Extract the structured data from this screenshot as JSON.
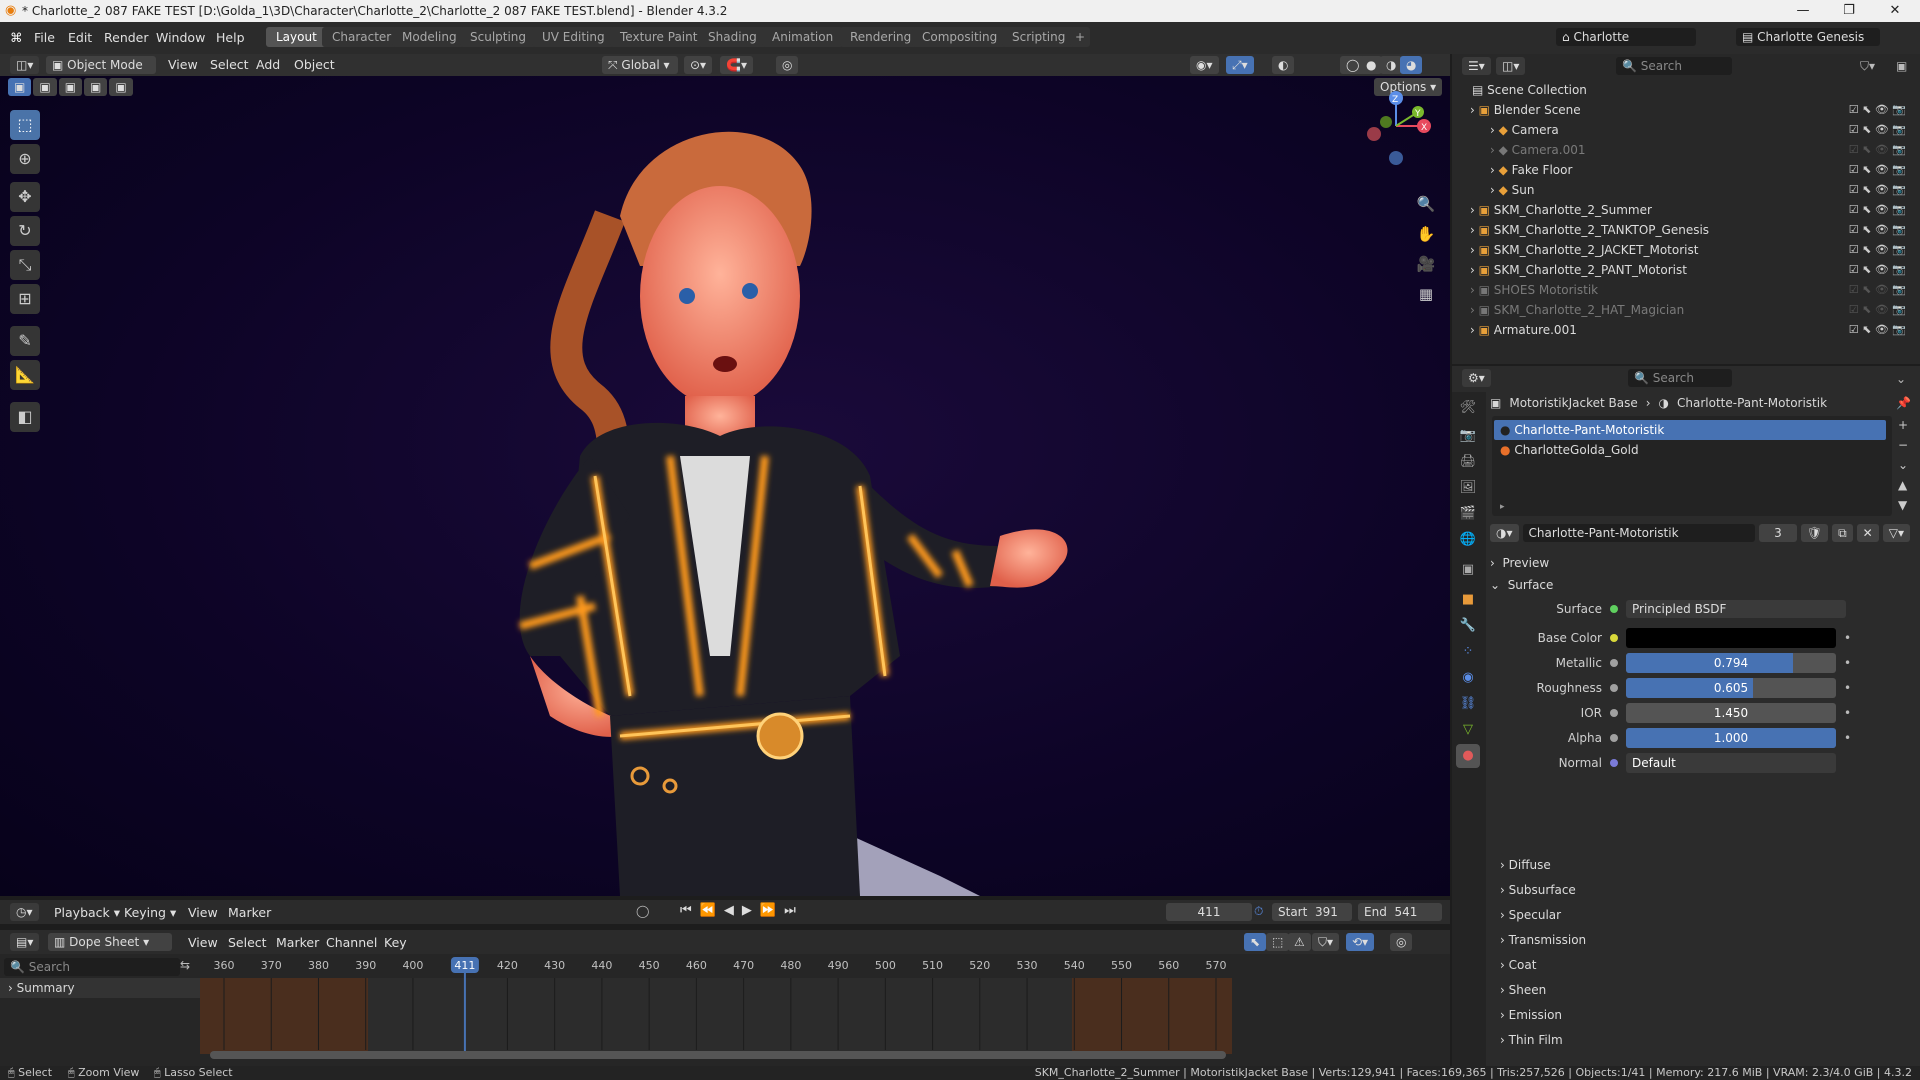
{
  "title": "* Charlotte_2 087 FAKE TEST [D:\\Golda_1\\3D\\Character\\Charlotte_2\\Charlotte_2 087 FAKE TEST.blend] - Blender 4.3.2",
  "menus": [
    "File",
    "Edit",
    "Render",
    "Window",
    "Help"
  ],
  "workspaces": [
    "Layout",
    "Character",
    "Modeling",
    "Sculpting",
    "UV Editing",
    "Texture Paint",
    "Shading",
    "Animation",
    "Rendering",
    "Compositing",
    "Scripting"
  ],
  "scene_name": "Charlotte",
  "view_layer": "Charlotte Genesis",
  "viewport": {
    "mode": "Object Mode",
    "menus": [
      "View",
      "Select",
      "Add",
      "Object"
    ],
    "orientation": "Global",
    "options": "Options"
  },
  "gizmo": {
    "z": "Z",
    "y": "Y",
    "x": "X"
  },
  "outliner": {
    "search": "Search",
    "root": "Scene Collection",
    "items": [
      {
        "label": "Blender Scene",
        "indent": 0,
        "dim": false
      },
      {
        "label": "Camera",
        "indent": 1,
        "dim": false
      },
      {
        "label": "Camera.001",
        "indent": 1,
        "dim": true
      },
      {
        "label": "Fake Floor",
        "indent": 1,
        "dim": false
      },
      {
        "label": "Sun",
        "indent": 1,
        "dim": false
      },
      {
        "label": "SKM_Charlotte_2_Summer",
        "indent": 0,
        "dim": false
      },
      {
        "label": "SKM_Charlotte_2_TANKTOP_Genesis",
        "indent": 0,
        "dim": false
      },
      {
        "label": "SKM_Charlotte_2_JACKET_Motorist",
        "indent": 0,
        "dim": false
      },
      {
        "label": "SKM_Charlotte_2_PANT_Motorist",
        "indent": 0,
        "dim": false
      },
      {
        "label": "SHOES Motoristik",
        "indent": 0,
        "dim": true
      },
      {
        "label": "SKM_Charlotte_2_HAT_Magician",
        "indent": 0,
        "dim": true
      },
      {
        "label": "Armature.001",
        "indent": 0,
        "dim": false
      }
    ]
  },
  "props": {
    "search": "Search",
    "breadcrumb": [
      "MotoristikJacket Base",
      "Charlotte-Pant-Motoristik"
    ],
    "slots": [
      "Charlotte-Pant-Motoristik",
      "CharlotteGolda_Gold"
    ],
    "material_name": "Charlotte-Pant-Motoristik",
    "users": "3",
    "preview": "Preview",
    "surface_section": "Surface",
    "surface_label": "Surface",
    "surface_value": "Principled BSDF",
    "fields": [
      {
        "label": "Base Color",
        "type": "color",
        "value": "",
        "color": "#000000"
      },
      {
        "label": "Metallic",
        "type": "slider",
        "value": "0.794",
        "fill": 0.794
      },
      {
        "label": "Roughness",
        "type": "slider",
        "value": "0.605",
        "fill": 0.605
      },
      {
        "label": "IOR",
        "type": "plain",
        "value": "1.450"
      },
      {
        "label": "Alpha",
        "type": "slider",
        "value": "1.000",
        "fill": 1.0
      },
      {
        "label": "Normal",
        "type": "link",
        "value": "Default"
      }
    ],
    "subsections": [
      "Diffuse",
      "Subsurface",
      "Specular",
      "Transmission",
      "Coat",
      "Sheen",
      "Emission",
      "Thin Film"
    ]
  },
  "timeline": {
    "menus": [
      "Playback",
      "Keying",
      "View",
      "Marker"
    ],
    "frame": "411",
    "start_label": "Start",
    "start": "391",
    "end_label": "End",
    "end": "541"
  },
  "dopesheet": {
    "mode": "Dope Sheet",
    "menus": [
      "View",
      "Select",
      "Marker",
      "Channel",
      "Key"
    ],
    "search": "Search",
    "summary": "Summary",
    "ticks": [
      "360",
      "370",
      "380",
      "390",
      "400",
      "411",
      "420",
      "430",
      "440",
      "450",
      "460",
      "470",
      "480",
      "490",
      "500",
      "510",
      "520",
      "530",
      "540",
      "550",
      "560",
      "570"
    ],
    "current": "411"
  },
  "status": {
    "left": [
      "Select",
      "Zoom View",
      "Lasso Select"
    ],
    "right": "SKM_Charlotte_2_Summer | MotoristikJacket Base | Verts:129,941 | Faces:169,365 | Tris:257,526 | Objects:1/41 | Memory: 217.6 MiB | VRAM: 2.3/4.0 GiB | 4.3.2"
  },
  "colors": {
    "accent": "#4772b3",
    "glow": "#ff9a1a",
    "bg": "#1d1d1d"
  }
}
